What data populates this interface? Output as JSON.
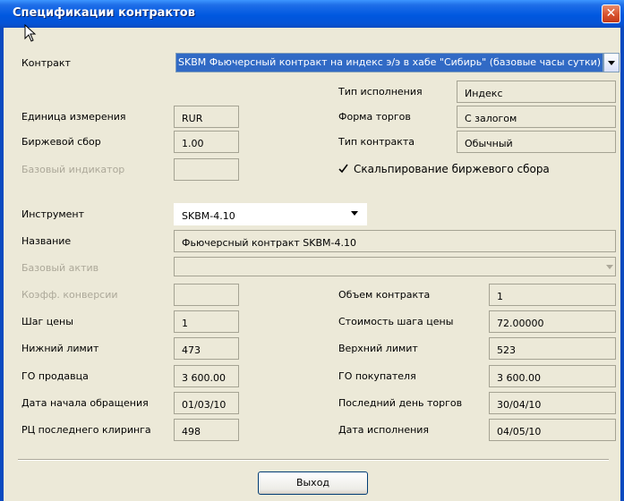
{
  "window": {
    "title": "Спецификации контрактов",
    "close_glyph": "✕"
  },
  "contract": {
    "label": "Контракт",
    "value": "SKBM  Фьючерсный контракт на индекс э/э в хабе \"Сибирь\" (базовые часы сутки)"
  },
  "exec_type": {
    "label": "Тип исполнения",
    "value": "Индекс"
  },
  "unit": {
    "label": "Единица измерения",
    "value": "RUR"
  },
  "trade_form": {
    "label": "Форма торгов",
    "value": "С залогом"
  },
  "fee": {
    "label": "Биржевой сбор",
    "value": "1.00"
  },
  "contract_type": {
    "label": "Тип контракта",
    "value": "Обычный"
  },
  "base_indicator": {
    "label": "Базовый индикатор",
    "value": ""
  },
  "scalping": {
    "label": "Скальпирование биржевого сбора",
    "checked": true
  },
  "instrument": {
    "label": "Инструмент",
    "value": "SKBM-4.10"
  },
  "name": {
    "label": "Название",
    "value": "Фьючерсный контракт SKBM-4.10"
  },
  "base_asset": {
    "label": "Базовый актив",
    "value": ""
  },
  "conv_coef": {
    "label": "Коэфф. конверсии",
    "value": ""
  },
  "contract_volume": {
    "label": "Объем контракта",
    "value": "1"
  },
  "price_step": {
    "label": "Шаг цены",
    "value": "1"
  },
  "step_cost": {
    "label": "Стоимость шага цены",
    "value": "72.00000"
  },
  "lower_limit": {
    "label": "Нижний лимит",
    "value": "473"
  },
  "upper_limit": {
    "label": "Верхний лимит",
    "value": "523"
  },
  "seller_margin": {
    "label": "ГО продавца",
    "value": "3 600.00"
  },
  "buyer_margin": {
    "label": "ГО покупателя",
    "value": "3 600.00"
  },
  "start_date": {
    "label": "Дата начала обращения",
    "value": "01/03/10"
  },
  "last_trade_day": {
    "label": "Последний день торгов",
    "value": "30/04/10"
  },
  "last_clearing_price": {
    "label": "РЦ последнего клиринга",
    "value": "498"
  },
  "exec_date": {
    "label": "Дата исполнения",
    "value": "04/05/10"
  },
  "exit_button": {
    "label": "Выход"
  }
}
